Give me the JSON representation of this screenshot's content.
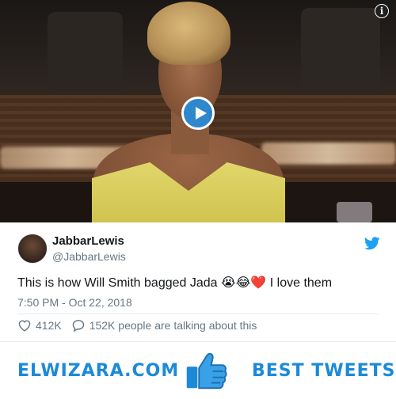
{
  "video": {
    "play_icon": "play-icon",
    "info_icon": "i"
  },
  "tweet": {
    "user_name": "JabbarLewis",
    "user_handle": "@JabbarLewis",
    "text": "This is how Will Smith bagged Jada",
    "emojis": "😭😂❤️",
    "text_suffix": " I love them",
    "timestamp": "7:50 PM - Oct 22, 2018",
    "likes": "412K",
    "replies_text": "152K people are talking about this",
    "brand_color": "#1da1f2",
    "heart_color": "#657786"
  },
  "banner": {
    "site_name": "ELWIZARA.COM",
    "tagline": "BEST TWEETS",
    "accent_color": "#1c8ad8"
  }
}
